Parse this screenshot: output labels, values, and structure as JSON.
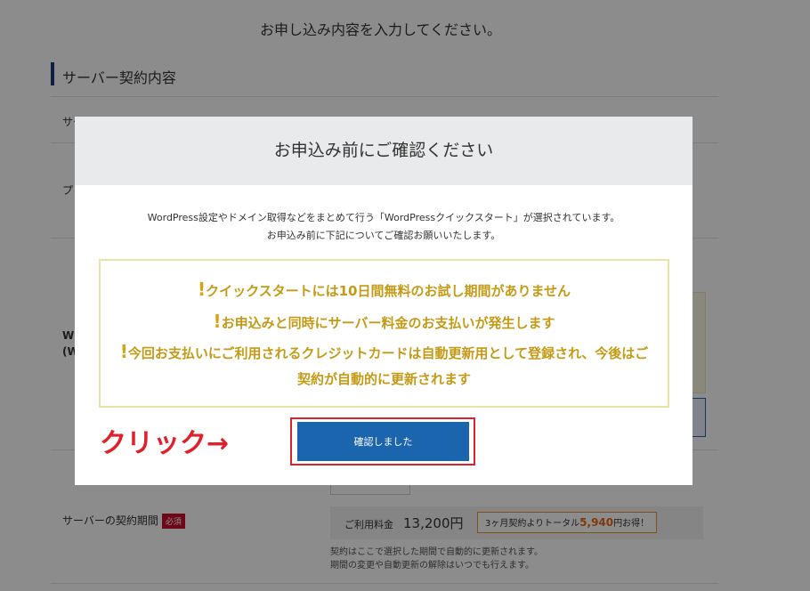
{
  "page": {
    "heading": "お申し込み内容を入力してください。",
    "section_title": "サーバー契約内容",
    "rows": {
      "server_id_label": "サーバーID",
      "plan_label_partial": "プ",
      "wp_label_partial_1": "W",
      "wp_label_partial_2": "(W",
      "period_label": "サーバーの契約期間",
      "required_badge": "必須"
    },
    "price": {
      "label": "ご利用料金",
      "value": "13,200円",
      "promo_prefix": "3ヶ月契約よりトータル",
      "promo_amount": "5,940",
      "promo_suffix": "円お得！"
    },
    "note_lines": [
      "契約はここで選択した期間で自動的に更新されます。",
      "期間の変更や自動更新の解除はいつでも行えます。"
    ]
  },
  "modal": {
    "title": "お申込み前にご確認ください",
    "desc_line1": "WordPress設定やドメイン取得などをまとめて行う「WordPressクイックスタート」が選択されています。",
    "desc_line2": "お申込み前に下記についてご確認お願いいたします。",
    "warnings": [
      "クイックスタートには10日間無料のお試し期間がありません",
      "お申込みと同時にサーバー料金のお支払いが発生します",
      "今回お支払いにご利用されるクレジットカードは自動更新用として登録され、今後はご契約が自動的に更新されます"
    ],
    "warning_mark": "!",
    "confirm_label": "確認しました"
  },
  "annotation": {
    "click_text": "クリック→"
  },
  "colors": {
    "accent_blue": "#1b64ae",
    "warning_gold": "#c49a17",
    "annotation_red": "#e0202a"
  }
}
